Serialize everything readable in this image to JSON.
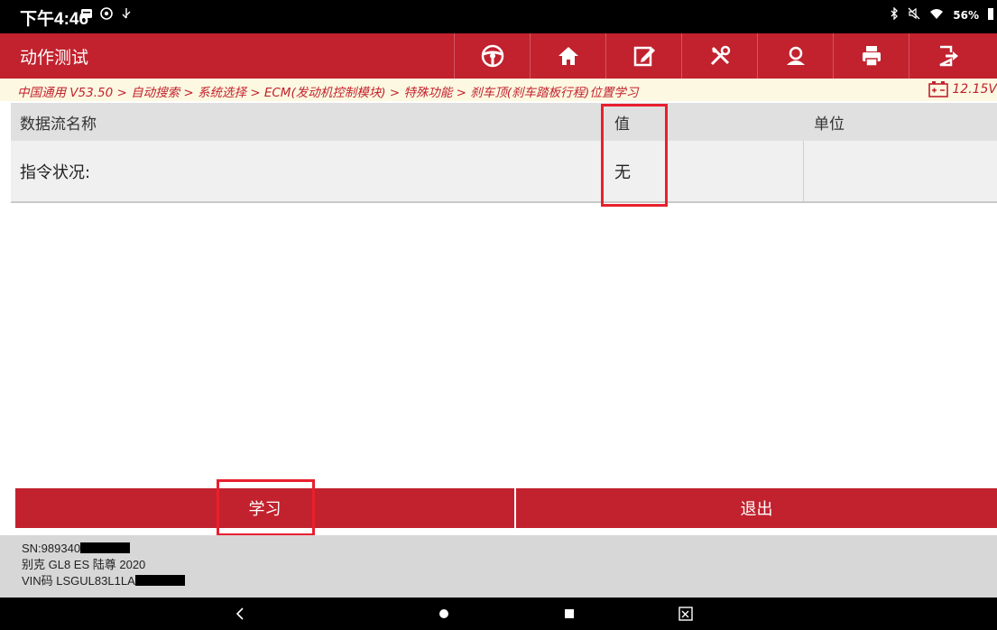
{
  "status_bar": {
    "time": "下午4:46",
    "battery_percent": "56%",
    "left_icons": [
      "gallery-icon",
      "settings-icon",
      "usb-icon"
    ],
    "right_icons": [
      "bluetooth-icon",
      "mute-icon",
      "wifi-icon",
      "battery-icon"
    ]
  },
  "header": {
    "title": "动作测试",
    "toolbar": [
      {
        "name": "steering-wheel-icon"
      },
      {
        "name": "home-icon"
      },
      {
        "name": "edit-report-icon"
      },
      {
        "name": "tools-icon"
      },
      {
        "name": "user-icon"
      },
      {
        "name": "print-icon"
      },
      {
        "name": "exit-icon"
      }
    ]
  },
  "breadcrumb": {
    "path": "中国通用 V53.50 > 自动搜索 > 系统选择 > ECM(发动机控制模块) > 特殊功能 > 刹车顶(刹车踏板行程)位置学习",
    "voltage": "12.15V"
  },
  "table": {
    "headers": [
      "数据流名称",
      "值",
      "单位"
    ],
    "rows": [
      {
        "name": "指令状况:",
        "value": "无",
        "unit": ""
      }
    ]
  },
  "actions": {
    "learn_label": "学习",
    "exit_label": "退出"
  },
  "device_info": {
    "sn": "SN:989340",
    "vehicle": "别克 GL8 ES 陆尊 2020",
    "vin": "VIN码 LSGUL83L1LA"
  },
  "colors": {
    "brand_red": "#c1222e",
    "highlight_red": "#e8202e",
    "breadcrumb_bg": "#fdf8e1"
  }
}
